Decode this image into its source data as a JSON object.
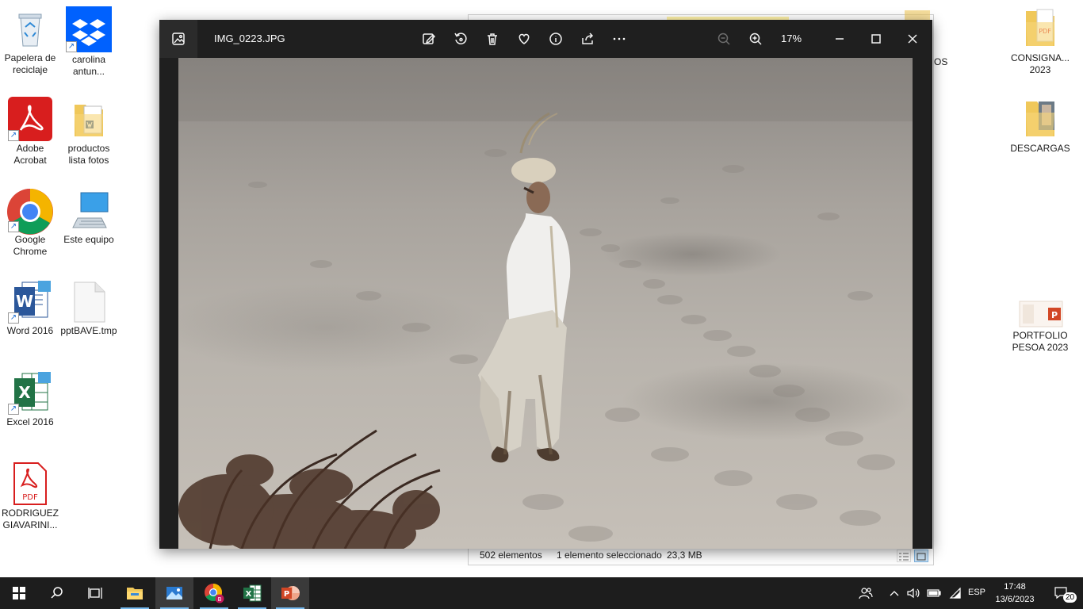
{
  "desktop": {
    "left_icons": [
      {
        "label": "Papelera de\nreciclaje",
        "icon": "recycle-bin-icon"
      },
      {
        "label": "carolina\nantun...",
        "icon": "dropbox-icon"
      },
      {
        "label": "Adobe\nAcrobat",
        "icon": "acrobat-icon"
      },
      {
        "label": "productos\nlista fotos",
        "icon": "folder-icon"
      },
      {
        "label": "Google\nChrome",
        "icon": "chrome-icon"
      },
      {
        "label": "Este equipo",
        "icon": "computer-icon"
      },
      {
        "label": "Word 2016",
        "icon": "word-icon"
      },
      {
        "label": "pptBAVE.tmp",
        "icon": "file-icon"
      },
      {
        "label": "Excel 2016",
        "icon": "excel-icon"
      },
      {
        "label": "RODRIGUEZ\nGIAVARINI...",
        "icon": "pdf-icon"
      }
    ],
    "right_icons": [
      {
        "label": "CONSIGNA...\n2023",
        "icon": "pdf-folder-icon"
      },
      {
        "label": "DESCARGAS",
        "icon": "folder-icon"
      },
      {
        "label": "PORTFOLIO\nPESOA 2023",
        "icon": "powerpoint-icon"
      }
    ],
    "partial_behind_text": "OS"
  },
  "explorer": {
    "status_items": "502 elementos",
    "status_selected": "1 elemento seleccionado",
    "status_size": "23,3 MB"
  },
  "viewer": {
    "file_name": "IMG_0223.JPG",
    "zoom": "17%",
    "toolbar": [
      "edit-icon",
      "rotate-icon",
      "delete-icon",
      "favorite-icon",
      "info-icon",
      "share-icon",
      "more-icon"
    ],
    "zoom_out": "zoom-out-icon",
    "zoom_in": "zoom-in-icon",
    "window_controls": [
      "minimize-icon",
      "maximize-icon",
      "close-icon"
    ]
  },
  "taskbar": {
    "apps": [
      "start-icon",
      "search-icon",
      "task-view-icon",
      "file-explorer-icon",
      "photos-icon",
      "chrome-icon",
      "excel-icon",
      "powerpoint-icon"
    ],
    "language": "ESP",
    "time": "17:48",
    "date": "13/6/2023",
    "notifications": "20"
  },
  "colors": {
    "viewer_bg": "#1f1f1f",
    "taskbar_bg": "#1d1d1d",
    "accent": "#76b9ed"
  }
}
